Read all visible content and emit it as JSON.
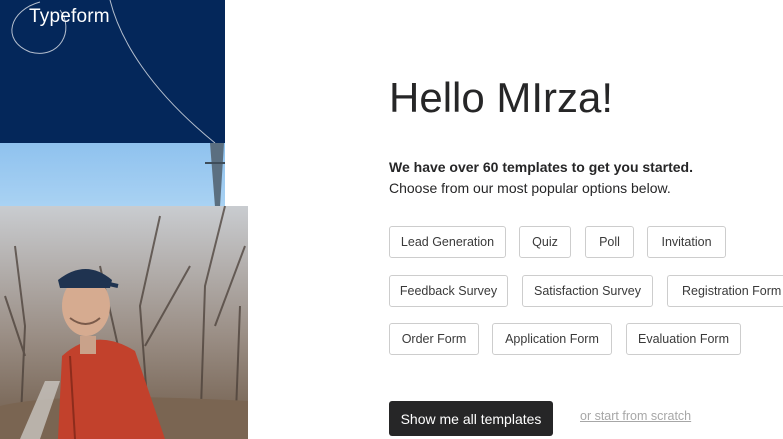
{
  "brand": {
    "logo_text": "Typeform",
    "navy": "#04275a"
  },
  "main": {
    "greeting": "Hello MIrza!",
    "intro_bold": "We have over 60 templates to get you started.",
    "intro_text": "Choose from our most popular options below."
  },
  "templates": [
    "Lead Generation",
    "Quiz",
    "Poll",
    "Invitation",
    "Feedback Survey",
    "Satisfaction Survey",
    "Registration Form",
    "Order Form",
    "Application Form",
    "Evaluation Form"
  ],
  "actions": {
    "show_all_label": "Show me all templates",
    "scratch_label": "or start from scratch"
  }
}
